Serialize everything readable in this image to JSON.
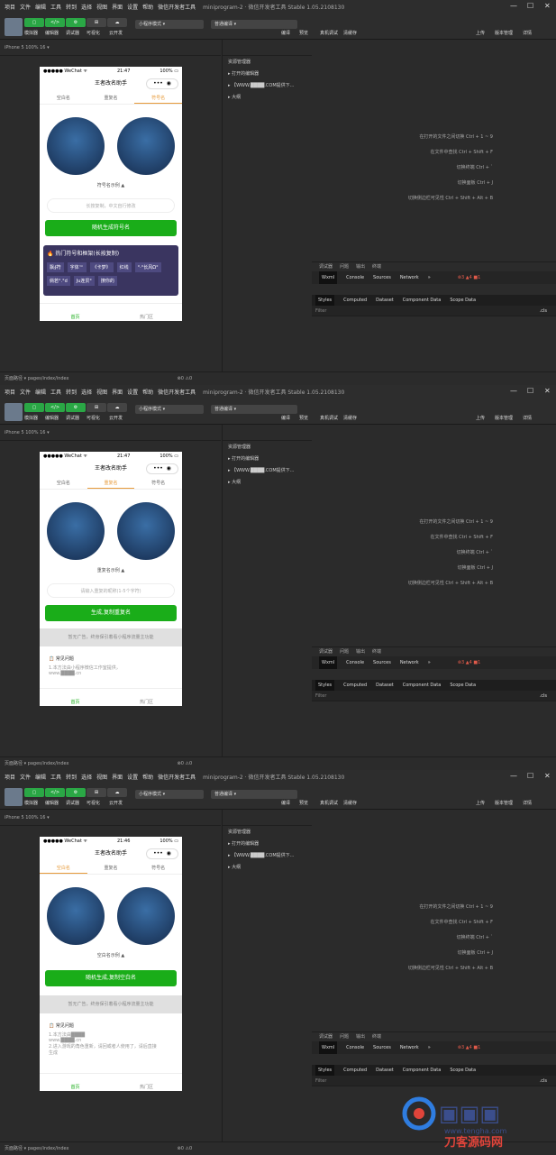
{
  "menu": [
    "项目",
    "文件",
    "编辑",
    "工具",
    "转到",
    "选择",
    "视图",
    "界面",
    "设置",
    "帮助",
    "微信开发者工具"
  ],
  "window_title": "miniprogram-2 · 微信开发者工具 Stable 1.05.2108130",
  "toolbar": {
    "left": [
      "模拟器",
      "编辑器",
      "调试器",
      "可视化",
      "云开发"
    ],
    "mode": "小程序模式",
    "compile": "普通编译",
    "mid": [
      "编译",
      "预览",
      "真机调试",
      "清缓存"
    ],
    "right": [
      "上传",
      "版本管理",
      "详情"
    ]
  },
  "device": "iPhone 5 100% 16 ▾",
  "explorer": {
    "title": "资源管理器",
    "items": [
      "打开的编辑器",
      "【WWW.████.COM提供下...",
      "大纲"
    ]
  },
  "shortcuts": [
    {
      "label": "在打开的文件之间切换",
      "keys": "Ctrl + 1 ~ 9"
    },
    {
      "label": "在文件中查找",
      "keys": "Ctrl + Shift + F"
    },
    {
      "label": "切换终端",
      "keys": "Ctrl + `"
    },
    {
      "label": "切换面板",
      "keys": "Ctrl + J"
    },
    {
      "label": "切换侧边栏可见性",
      "keys": "Ctrl + Shift + Alt + B"
    }
  ],
  "devtools": {
    "top": [
      "调试器",
      "问题",
      "输出",
      "终端"
    ],
    "tabs": [
      "Wxml",
      "Console",
      "Sources",
      "Network",
      "»"
    ],
    "counts": "⊗3 ▲4 ■1",
    "sub": [
      "Styles",
      "Computed",
      "Dataset",
      "Component Data",
      "Scope Data"
    ],
    "filter": "Filter",
    "cls": ".cls"
  },
  "footer": {
    "path": "页面路径 ▾    pages/index/index",
    "errors": "⊗0 ⚠0"
  },
  "app": {
    "title": "王者改名助手",
    "tabs": [
      "空白名",
      "重复名",
      "符号名"
    ],
    "nav": [
      "首页",
      "热门区"
    ],
    "faq_title": "常见问题"
  },
  "screens": [
    {
      "time": "21:47",
      "active_tab": 2,
      "sample": "符号名示例 ▲",
      "input": "长按复制，中文自行修改",
      "button": "随机生成符号名",
      "banner": "热门符号和框架(长按复制)",
      "chips": [
        "飘∮符",
        "字体™",
        "《卡梦》",
        "红线",
        "°·°长风Ω°",
        "倘若°.°d",
        "Ju连贯°",
        "撩你的"
      ],
      "tail": ""
    },
    {
      "time": "21:47",
      "active_tab": 1,
      "sample": "重复名示例 ▲",
      "input": "请输入重复的昵称(1-5个字符)",
      "button": "生成,复制重复名",
      "banner": "暂无广告，终身保引着看小程序流量主功能",
      "faq": [
        "1.本方法由小程序微信工作室提供，",
        "www.████.cn"
      ]
    },
    {
      "time": "21:46",
      "active_tab": 0,
      "sample": "空白名示例 ▲",
      "input": "",
      "button": "随机生成,复制空白名",
      "banner": "暂无广告，终身保引着看小程序流量主功能",
      "faq": [
        "1.本方法由████",
        "www.████.cn",
        "2.进入游戏的角色重新，请回或者人使用了，请后直接",
        "生成"
      ]
    }
  ],
  "watermark": {
    "text": "www.tengha.com",
    "brand": "刀客源码网"
  }
}
